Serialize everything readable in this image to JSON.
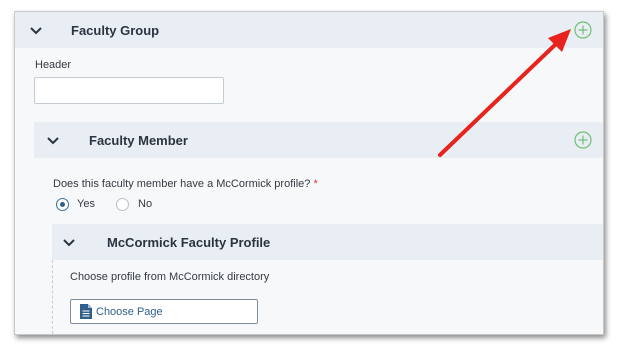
{
  "faculty_group": {
    "title": "Faculty Group",
    "header_label": "Header",
    "header_value": ""
  },
  "faculty_member": {
    "title": "Faculty Member",
    "question": "Does this faculty member have a McCormick profile?",
    "required_mark": "*",
    "options": [
      {
        "label": "Yes",
        "selected": true
      },
      {
        "label": "No",
        "selected": false
      }
    ]
  },
  "profile": {
    "title": "McCormick Faculty Profile",
    "instruction": "Choose profile from McCormick directory",
    "choose_button": "Choose Page"
  },
  "colors": {
    "header_bg": "#e9eef4",
    "plus_green": "#6fbf73",
    "arrow_red": "#e8221c",
    "link_blue": "#2f5f8a"
  },
  "icons": [
    "chevron-down-icon",
    "plus-circle-icon",
    "document-icon",
    "red-arrow"
  ]
}
